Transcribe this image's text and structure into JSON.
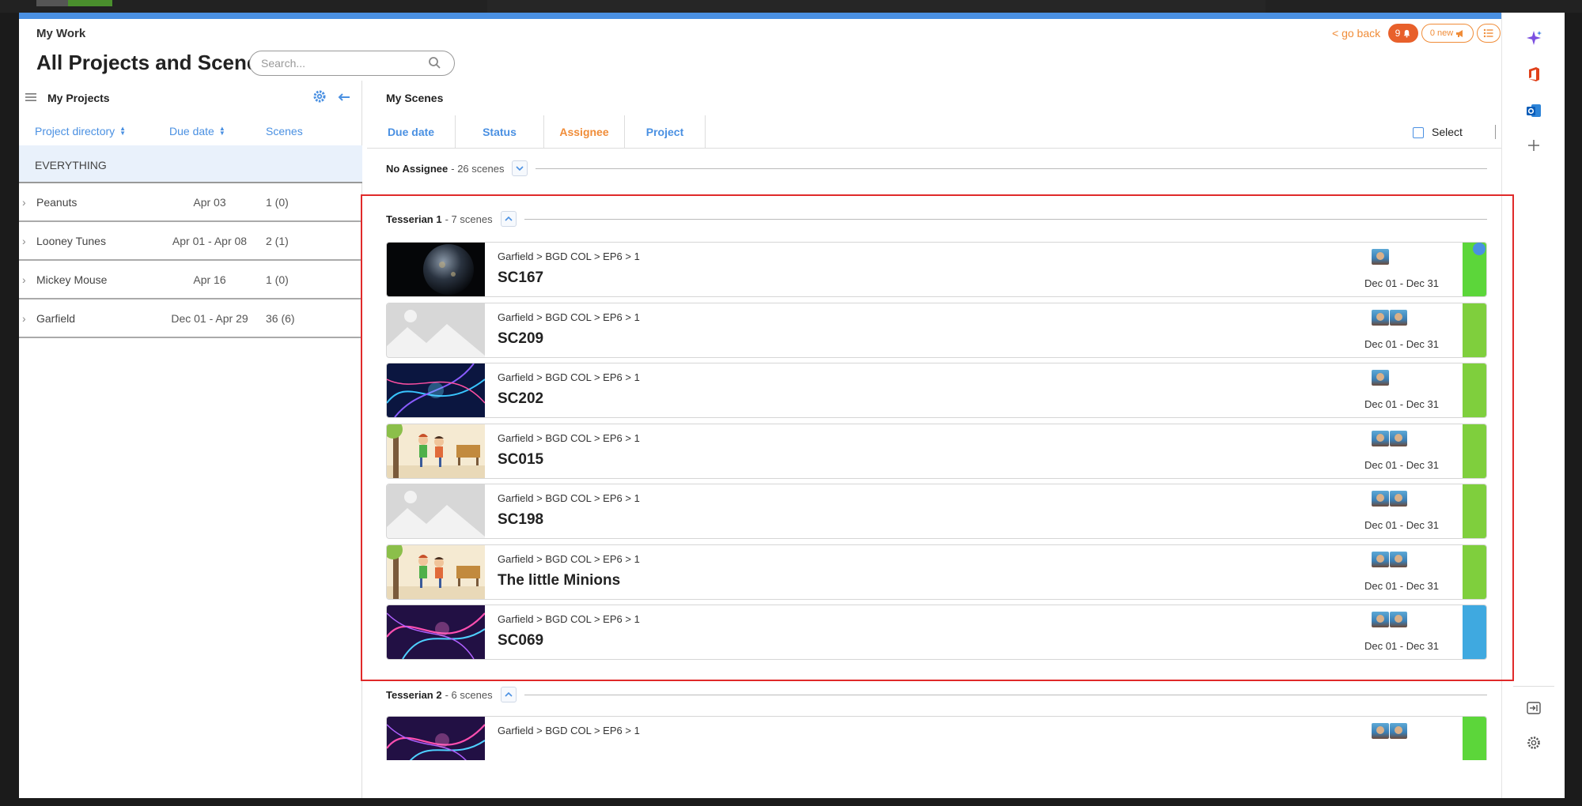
{
  "header": {
    "section": "My Work",
    "title": "All Projects and Scenes",
    "search_placeholder": "Search...",
    "go_back": "< go back",
    "notif_count": "9",
    "new_label": "0 new"
  },
  "left_panel": {
    "title": "My Projects",
    "columns": {
      "project": "Project directory",
      "due": "Due date",
      "scenes": "Scenes"
    },
    "everything": "EVERYTHING",
    "projects": [
      {
        "name": "Peanuts",
        "due": "Apr 03",
        "scenes": "1 (0)"
      },
      {
        "name": "Looney Tunes",
        "due": "Apr 01 - Apr 08",
        "scenes": "2 (1)"
      },
      {
        "name": "Mickey Mouse",
        "due": "Apr 16",
        "scenes": "1 (0)"
      },
      {
        "name": "Garfield",
        "due": "Dec 01 - Apr 29",
        "scenes": "36 (6)"
      }
    ]
  },
  "right_panel": {
    "title": "My Scenes",
    "tabs": [
      "Due date",
      "Status",
      "Assignee",
      "Project"
    ],
    "active_tab": "Assignee",
    "select_label": "Select",
    "groups": [
      {
        "name": "No Assignee",
        "count": "- 26 scenes"
      },
      {
        "name": "Tesserian 1",
        "count": "- 7 scenes"
      },
      {
        "name": "Tesserian 2",
        "count": "- 6 scenes"
      }
    ],
    "scenes": [
      {
        "path": "Garfield > BGD COL > EP6 > 1",
        "name": "SC167",
        "dates": "Dec 01 - Dec 31",
        "thumb": "earth",
        "status_color": "#5cd63a",
        "avatars": 1
      },
      {
        "path": "Garfield > BGD COL > EP6 > 1",
        "name": "SC209",
        "dates": "Dec 01 - Dec 31",
        "thumb": "placeholder",
        "status_color": "#7fcf3d",
        "avatars": 2
      },
      {
        "path": "Garfield > BGD COL > EP6 > 1",
        "name": "SC202",
        "dates": "Dec 01 - Dec 31",
        "thumb": "plasma-blue",
        "status_color": "#7fcf3d",
        "avatars": 1
      },
      {
        "path": "Garfield > BGD COL > EP6 > 1",
        "name": "SC015",
        "dates": "Dec 01 - Dec 31",
        "thumb": "cartoon",
        "status_color": "#7fcf3d",
        "avatars": 2
      },
      {
        "path": "Garfield > BGD COL > EP6 > 1",
        "name": "SC198",
        "dates": "Dec 01 - Dec 31",
        "thumb": "placeholder",
        "status_color": "#7fcf3d",
        "avatars": 2
      },
      {
        "path": "Garfield > BGD COL > EP6 > 1",
        "name": "The little Minions",
        "dates": "Dec 01 - Dec 31",
        "thumb": "cartoon",
        "status_color": "#7fcf3d",
        "avatars": 2
      },
      {
        "path": "Garfield > BGD COL > EP6 > 1",
        "name": "SC069",
        "dates": "Dec 01 - Dec 31",
        "thumb": "plasma-pink",
        "status_color": "#3fa9e0",
        "avatars": 2
      },
      {
        "path": "Garfield > BGD COL > EP6 > 1",
        "name": "",
        "dates": "",
        "thumb": "plasma-pink",
        "status_color": "#5cd63a",
        "avatars": 2
      }
    ]
  },
  "colors": {
    "accent": "#4a90e2",
    "orange": "#f08c38",
    "highlight": "#e02a2a"
  }
}
